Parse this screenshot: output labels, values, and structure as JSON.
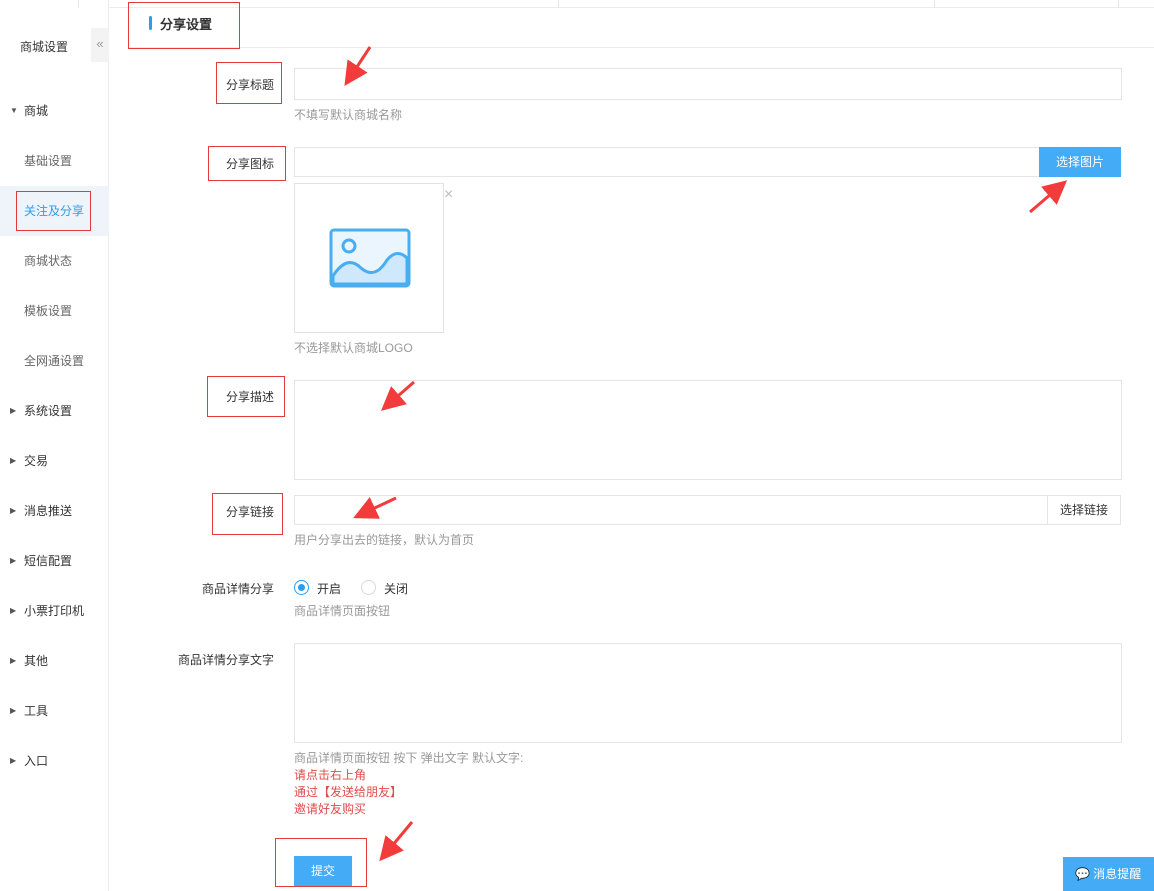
{
  "sidebar": {
    "title": "商城设置",
    "collapse_icon": "«",
    "items": [
      {
        "label": "商城"
      },
      {
        "label": "基础设置"
      },
      {
        "label": "关注及分享"
      },
      {
        "label": "商城状态"
      },
      {
        "label": "模板设置"
      },
      {
        "label": "全网通设置"
      },
      {
        "label": "系统设置"
      },
      {
        "label": "交易"
      },
      {
        "label": "消息推送"
      },
      {
        "label": "短信配置"
      },
      {
        "label": "小票打印机"
      },
      {
        "label": "其他"
      },
      {
        "label": "工具"
      },
      {
        "label": "入口"
      }
    ]
  },
  "header": {
    "title": "分享设置"
  },
  "form": {
    "share_title": {
      "label": "分享标题",
      "value": "",
      "hint": "不填写默认商城名称"
    },
    "share_icon": {
      "label": "分享图标",
      "value": "",
      "button": "选择图片",
      "hint": "不选择默认商城LOGO",
      "remove": "×"
    },
    "share_desc": {
      "label": "分享描述",
      "value": ""
    },
    "share_link": {
      "label": "分享链接",
      "value": "",
      "button": "选择链接",
      "hint": "用户分享出去的链接，默认为首页"
    },
    "detail_share": {
      "label": "商品详情分享",
      "option_on": "开启",
      "option_off": "关闭",
      "selected": "开启",
      "hint": "商品详情页面按钮"
    },
    "detail_share_text": {
      "label": "商品详情分享文字",
      "value": "",
      "hint": "商品详情页面按钮 按下 弹出文字 默认文字:",
      "default_lines": [
        "请点击右上角",
        "通过【发送给朋友】",
        "邀请好友购买"
      ]
    },
    "submit": "提交"
  },
  "floating": {
    "message_button": "消息提醒"
  },
  "colors": {
    "accent": "#2b9ded",
    "button": "#44abf7",
    "annotation": "#e23b3b",
    "warning_text": "#e04b4b"
  }
}
